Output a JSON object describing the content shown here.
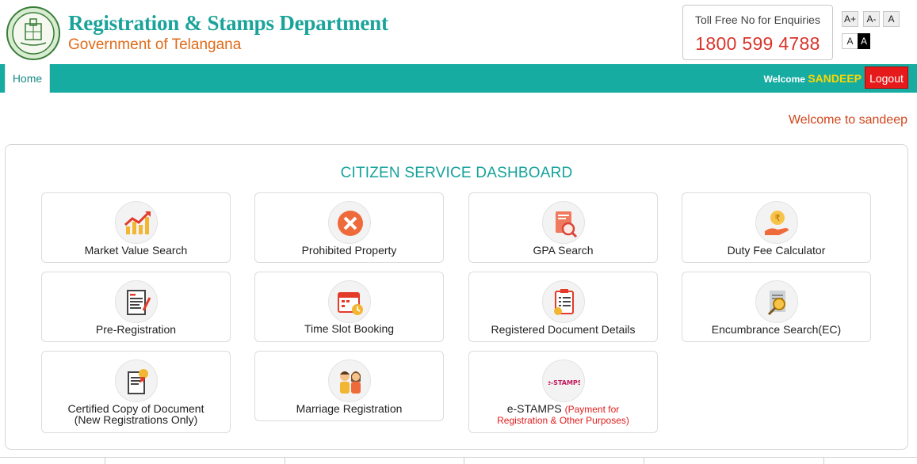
{
  "header": {
    "title": "Registration & Stamps Department",
    "subtitle": "Government of Telangana",
    "toll_label": "Toll Free No for Enquiries",
    "toll_number": "1800 599 4788",
    "font_controls": {
      "increase": "A+",
      "decrease": "A-",
      "normal": "A",
      "light": "A",
      "dark": "A"
    }
  },
  "nav": {
    "home": "Home",
    "welcome_prefix": "Welcome",
    "username": "SANDEEP",
    "logout": "Logout"
  },
  "welcome_message": "Welcome to sandeep",
  "dashboard": {
    "title": "CITIZEN SERVICE DASHBOARD",
    "cards": [
      {
        "label": "Market Value Search",
        "icon": "chart-icon"
      },
      {
        "label": "Prohibited Property",
        "icon": "prohibited-icon"
      },
      {
        "label": "GPA Search",
        "icon": "document-search-icon"
      },
      {
        "label": "Duty Fee Calculator",
        "icon": "rupee-hand-icon"
      },
      {
        "label": "Pre-Registration",
        "icon": "form-icon"
      },
      {
        "label": "Time Slot Booking",
        "icon": "calendar-clock-icon"
      },
      {
        "label": "Registered Document Details",
        "icon": "clipboard-icon"
      },
      {
        "label": "Encumbrance Search(EC)",
        "icon": "document-magnify-icon"
      },
      {
        "label": "Certified Copy of Document",
        "label2": "(New Registrations Only)",
        "icon": "certificate-icon"
      },
      {
        "label": "Marriage Registration",
        "icon": "couple-icon"
      },
      {
        "label": "e-STAMPS",
        "label_red": "(Payment for",
        "label2": "Registration & Other Purposes)",
        "icon": "estamps-icon",
        "logo_text": "e-STAMPS"
      }
    ]
  },
  "colors": {
    "teal": "#16aca2",
    "orange": "#e06a17",
    "red": "#e51b1b",
    "gold": "#ffd700"
  }
}
